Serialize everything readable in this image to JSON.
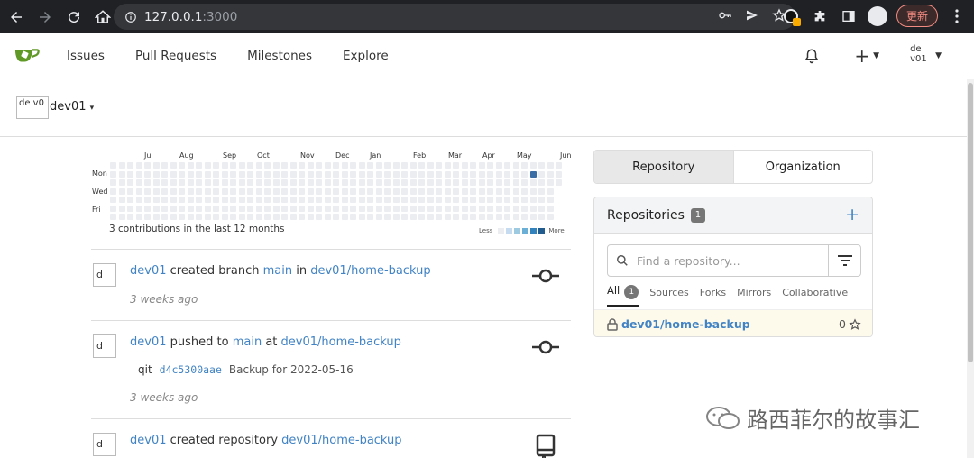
{
  "browser": {
    "url_host": "127.0.0.1",
    "url_port": ":3000",
    "update_label": "更新"
  },
  "header": {
    "menu": [
      "Issues",
      "Pull Requests",
      "Milestones",
      "Explore"
    ],
    "avatar_alt": "de v01"
  },
  "context": {
    "username": "dev01",
    "avatar_alt": "de v0"
  },
  "heatmap": {
    "months": [
      "Jul",
      "Aug",
      "Sep",
      "Oct",
      "Nov",
      "Dec",
      "Jan",
      "Feb",
      "Mar",
      "Apr",
      "May",
      "Jun"
    ],
    "days": [
      "Mon",
      "Wed",
      "Fri"
    ],
    "caption": "3 contributions in the last 12 months",
    "legend_less": "Less",
    "legend_more": "More",
    "legend_colors": [
      "#ebedf0",
      "#c6dbef",
      "#9ecae1",
      "#6baed6",
      "#3182bd",
      "#225c8e"
    ],
    "active_color": "#3a6ea5"
  },
  "feed": [
    {
      "avatar_alt": "d",
      "actor": "dev01",
      "verb": " created branch ",
      "ref": "main",
      "prep": " in ",
      "repo": "dev01/home-backup",
      "time": "3 weeks ago"
    },
    {
      "avatar_alt": "d",
      "actor": "dev01",
      "verb": " pushed to ",
      "ref": "main",
      "prep": " at ",
      "repo": "dev01/home-backup",
      "commit_prefix": "qit",
      "commit_sha": "d4c5300aae",
      "commit_msg": "Backup for 2022-05-16",
      "time": "3 weeks ago"
    },
    {
      "avatar_alt": "d",
      "actor": "dev01",
      "verb": " created repository ",
      "repo": "dev01/home-backup"
    }
  ],
  "sidebar": {
    "tabs": [
      "Repository",
      "Organization"
    ],
    "repos_title": "Repositories",
    "repos_count": "1",
    "search_placeholder": "Find a repository...",
    "subtabs": [
      "All",
      "Sources",
      "Forks",
      "Mirrors",
      "Collaborative"
    ],
    "all_count": "1",
    "repo_name": "dev01/home-backup",
    "repo_stars": "0"
  },
  "watermark": "路西菲尔的故事汇"
}
